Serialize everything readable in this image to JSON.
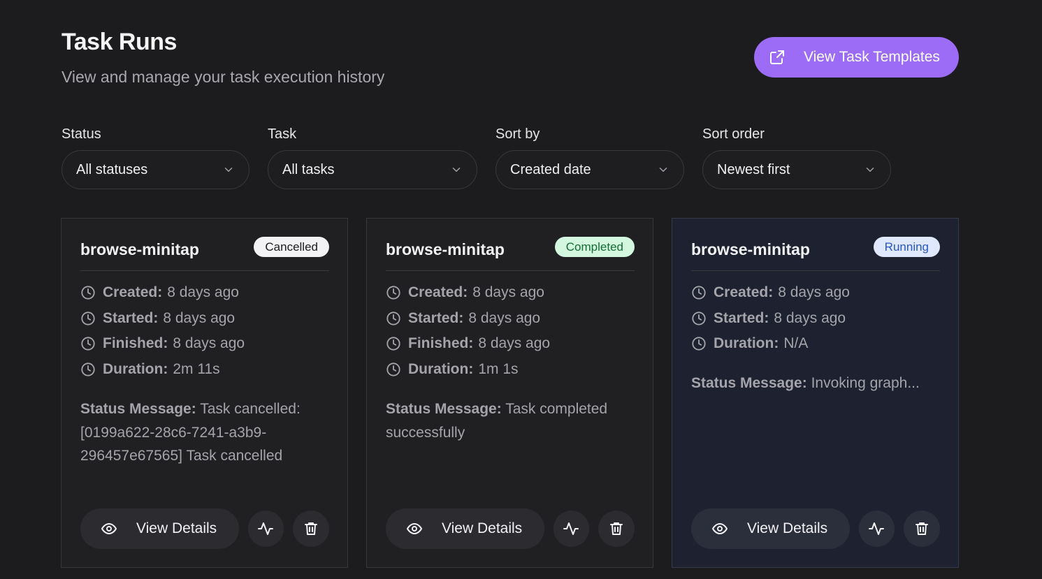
{
  "header": {
    "title": "Task Runs",
    "subtitle": "View and manage your task execution history",
    "templates_button": "View Task Templates",
    "templates_icon": "external-link-icon"
  },
  "colors": {
    "background": "#1c1c1f",
    "accent": "#9d6cf6",
    "badge_cancelled": "#f3f3f5",
    "badge_completed": "#d4f7df",
    "badge_running": "#dfe8fd"
  },
  "filters": [
    {
      "label": "Status",
      "value": "All statuses"
    },
    {
      "label": "Task",
      "value": "All tasks"
    },
    {
      "label": "Sort by",
      "value": "Created date"
    },
    {
      "label": "Sort order",
      "value": "Newest first"
    }
  ],
  "cards": [
    {
      "title": "browse-minitap",
      "status": "Cancelled",
      "meta": [
        {
          "key": "Created:",
          "value": "8 days ago"
        },
        {
          "key": "Started:",
          "value": "8 days ago"
        },
        {
          "key": "Finished:",
          "value": "8 days ago"
        },
        {
          "key": "Duration:",
          "value": "2m 11s"
        }
      ],
      "status_message_key": "Status Message:",
      "status_message": "Task cancelled: [0199a622-28c6-7241-a3b9-296457e67565] Task cancelled",
      "details_label": "View Details"
    },
    {
      "title": "browse-minitap",
      "status": "Completed",
      "meta": [
        {
          "key": "Created:",
          "value": "8 days ago"
        },
        {
          "key": "Started:",
          "value": "8 days ago"
        },
        {
          "key": "Finished:",
          "value": "8 days ago"
        },
        {
          "key": "Duration:",
          "value": "1m 1s"
        }
      ],
      "status_message_key": "Status Message:",
      "status_message": "Task completed successfully",
      "details_label": "View Details"
    },
    {
      "title": "browse-minitap",
      "status": "Running",
      "meta": [
        {
          "key": "Created:",
          "value": "8 days ago"
        },
        {
          "key": "Started:",
          "value": "8 days ago"
        },
        {
          "key": "Duration:",
          "value": "N/A"
        }
      ],
      "status_message_key": "Status Message:",
      "status_message": "Invoking graph...",
      "details_label": "View Details"
    }
  ]
}
